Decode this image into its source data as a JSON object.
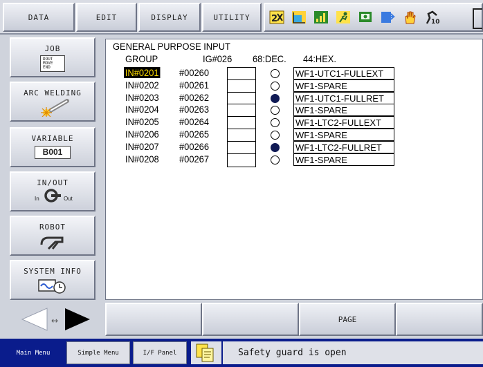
{
  "topmenu": {
    "data": "DATA",
    "edit": "EDIT",
    "display": "DISPLAY",
    "utility": "UTILITY"
  },
  "toolbar_icons": [
    "speed-2x-icon",
    "chart-icon",
    "signal-bars-icon",
    "running-person-icon",
    "monitor-icon",
    "edit-page-icon",
    "hand-icon",
    "robot-10-icon"
  ],
  "sidebar": {
    "job": {
      "label": "JOB",
      "sub": "DOUT MOVE END"
    },
    "arc": {
      "label": "ARC WELDING"
    },
    "variable": {
      "label": "VARIABLE",
      "sub": "B001"
    },
    "inout": {
      "label": "IN/OUT",
      "in": "In",
      "out": "Out"
    },
    "robot": {
      "label": "ROBOT"
    },
    "sysinfo": {
      "label": "SYSTEM INFO"
    }
  },
  "content": {
    "title": "GENERAL PURPOSE INPUT",
    "group_label": "GROUP",
    "group_id": "IG#026",
    "group_dec": "68:DEC.",
    "group_hex": "44:HEX.",
    "rows": [
      {
        "id": "IN#0201",
        "addr": "#00260",
        "on": false,
        "name": "WF1-UTC1-FULLEXT"
      },
      {
        "id": "IN#0202",
        "addr": "#00261",
        "on": false,
        "name": "WF1-SPARE"
      },
      {
        "id": "IN#0203",
        "addr": "#00262",
        "on": true,
        "name": "WF1-UTC1-FULLRET"
      },
      {
        "id": "IN#0204",
        "addr": "#00263",
        "on": false,
        "name": "WF1-SPARE"
      },
      {
        "id": "IN#0205",
        "addr": "#00264",
        "on": false,
        "name": "WF1-LTC2-FULLEXT"
      },
      {
        "id": "IN#0206",
        "addr": "#00265",
        "on": false,
        "name": "WF1-SPARE"
      },
      {
        "id": "IN#0207",
        "addr": "#00266",
        "on": true,
        "name": "WF1-LTC2-FULLRET"
      },
      {
        "id": "IN#0208",
        "addr": "#00267",
        "on": false,
        "name": "WF1-SPARE"
      }
    ]
  },
  "fkeys": {
    "page": "PAGE"
  },
  "status": {
    "main_menu": "Main Menu",
    "simple_menu": "Simple Menu",
    "if_panel": "I/F Panel",
    "message": "Safety guard is open"
  },
  "colors": {
    "selected_bg": "#000000",
    "selected_fg": "#ffdc00",
    "status_bar": "#0a1c8c",
    "lamp_on": "#101a55"
  }
}
